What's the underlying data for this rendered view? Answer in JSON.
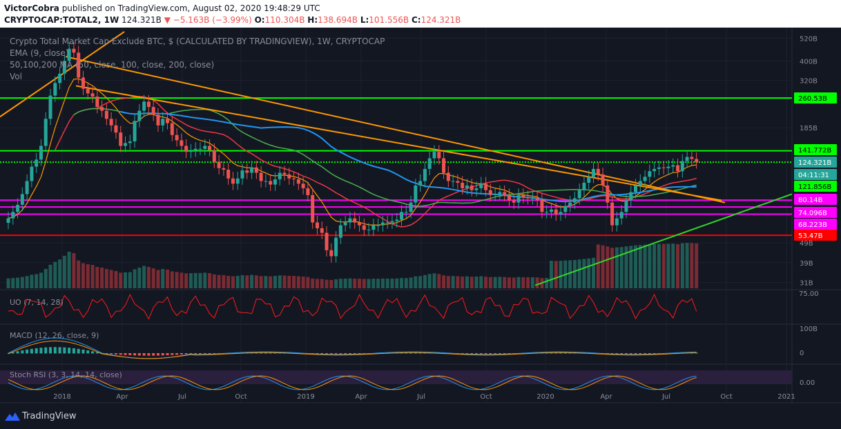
{
  "header": {
    "author": "VictorCobra",
    "published_text": "published on TradingView.com, August 02, 2020 19:48:29 UTC",
    "symbol": "CRYPTOCAP:TOTAL2, 1W",
    "last": "124.321B",
    "change": "▼ −5.163B (−3.99%)",
    "o_label": "O:",
    "o_val": "110.304B",
    "h_label": "H:",
    "h_val": "138.694B",
    "l_label": "L:",
    "l_val": "101.556B",
    "c_label": "C:",
    "c_val": "124.321B"
  },
  "legend": {
    "title": "Crypto Total Market Cap Exclude BTC, $ (CALCULATED BY TRADINGVIEW), 1W, CRYPTOCAP",
    "ema": "EMA (9, close)",
    "ma": "50,100,200 MA (50, close, 100, close, 200, close)",
    "vol": "Vol"
  },
  "panes": {
    "uo": "UO (7, 14, 28)",
    "macd": "MACD (12, 26, close, 9)",
    "stoch": "Stoch RSI (3, 3, 14, 14, close)"
  },
  "footer": {
    "brand": "TradingView"
  },
  "colors": {
    "bg": "#131722",
    "up": "#26a69a",
    "down": "#ef5350",
    "ema": "#ff9800",
    "ma50": "#4caf50",
    "ma100": "#f23645",
    "ma200": "#2196f3",
    "trend_orange": "#ff9800",
    "trend_green": "#33d62b",
    "magenta": "#ff00ff",
    "green_level": "#00ff00",
    "red_level": "#ff0000"
  },
  "chart_data": {
    "type": "candlestick",
    "scale": "log",
    "x_ticks": [
      "2018",
      "Apr",
      "Jul",
      "Oct",
      "2019",
      "Apr",
      "Jul",
      "Oct",
      "2020",
      "Apr",
      "Jul",
      "Oct",
      "2021"
    ],
    "y_ticks": [
      "520B",
      "400B",
      "320B",
      "185B",
      "49B",
      "39B",
      "31B"
    ],
    "y_tick_values": [
      520,
      400,
      320,
      185,
      49,
      39,
      31
    ],
    "y_range": [
      29,
      560
    ],
    "price_labels": [
      {
        "text": "260.53B",
        "value": 260.53,
        "bg": "#00ff00",
        "fg": "#000000"
      },
      {
        "text": "141.772B",
        "value": 141.772,
        "bg": "#00ff00",
        "fg": "#000000"
      },
      {
        "text": "124.321B",
        "value": 124.321,
        "bg": "#26a69a",
        "fg": "#ffffff"
      },
      {
        "text": "04:11:31",
        "value": 0,
        "bg": "#26a69a",
        "fg": "#ffffff"
      },
      {
        "text": "121.856B",
        "value": 121.856,
        "bg": "#00ff00",
        "fg": "#000000"
      },
      {
        "text": "80.14B",
        "value": 80.14,
        "bg": "#ff00ff",
        "fg": "#ffffff"
      },
      {
        "text": "74.096B",
        "value": 74.096,
        "bg": "#ff00ff",
        "fg": "#ffffff"
      },
      {
        "text": "68.223B",
        "value": 68.223,
        "bg": "#ff00ff",
        "fg": "#ffffff"
      },
      {
        "text": "53.47B",
        "value": 53.47,
        "bg": "#ff0000",
        "fg": "#ffffff"
      }
    ],
    "horizontal_levels": [
      {
        "value": 260.53,
        "color": "#00ff00"
      },
      {
        "value": 141.772,
        "color": "#00ff00"
      },
      {
        "value": 124.321,
        "color": "#00ff00",
        "dotted": true
      },
      {
        "value": 80.14,
        "color": "#ff00ff"
      },
      {
        "value": 74.096,
        "color": "#ff00ff"
      },
      {
        "value": 68.223,
        "color": "#ff00ff"
      },
      {
        "value": 53.47,
        "color": "#ff0000"
      }
    ],
    "closes": [
      65,
      70,
      76,
      86,
      100,
      118,
      128,
      150,
      205,
      268,
      310,
      345,
      400,
      460,
      440,
      330,
      290,
      275,
      265,
      235,
      225,
      205,
      190,
      175,
      150,
      155,
      158,
      200,
      225,
      250,
      235,
      215,
      190,
      205,
      195,
      170,
      160,
      150,
      140,
      142,
      145,
      145,
      150,
      143,
      125,
      116,
      114,
      103,
      97,
      103,
      113,
      110,
      117,
      110,
      100,
      100,
      96,
      102,
      110,
      108,
      103,
      102,
      97,
      92,
      85,
      62,
      58,
      55,
      45,
      42,
      52,
      60,
      62,
      65,
      62,
      60,
      57,
      57,
      60,
      60,
      62,
      62,
      63,
      64,
      70,
      70,
      78,
      95,
      100,
      115,
      130,
      140,
      130,
      110,
      100,
      100,
      98,
      92,
      95,
      90,
      92,
      97,
      90,
      85,
      86,
      88,
      85,
      80,
      78,
      85,
      83,
      82,
      82,
      80,
      70,
      70,
      72,
      68,
      70,
      75,
      78,
      82,
      90,
      98,
      105,
      115,
      108,
      95,
      78,
      60,
      65,
      70,
      80,
      88,
      95,
      100,
      105,
      112,
      115,
      117,
      116,
      118,
      120,
      112,
      126,
      132,
      129,
      124
    ]
  },
  "ui": {
    "uo_tick": "75.00",
    "macd_top": "100B",
    "macd_zero": "0",
    "stoch_tick": "0.00"
  }
}
